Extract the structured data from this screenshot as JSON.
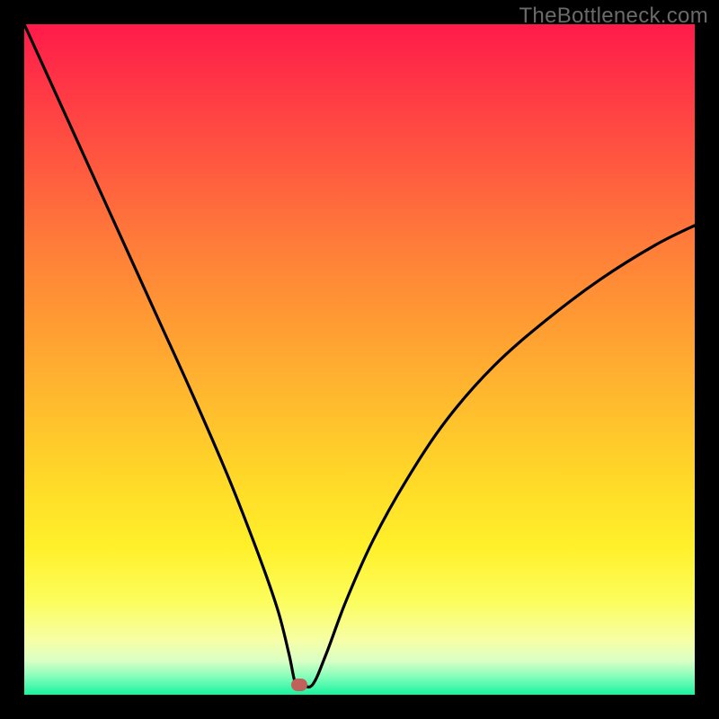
{
  "watermark": "TheBottleneck.com",
  "colors": {
    "frame": "#000000",
    "curve": "#000000",
    "marker": "#c1615b"
  },
  "chart_data": {
    "type": "line",
    "title": "",
    "xlabel": "",
    "ylabel": "",
    "xlim": [
      0,
      100
    ],
    "ylim": [
      0,
      100
    ],
    "series": [
      {
        "name": "bottleneck-curve",
        "x": [
          0,
          5,
          10,
          15,
          20,
          25,
          30,
          33,
          36,
          38,
          39.5,
          40.5,
          41.5,
          43,
          45,
          48,
          52,
          57,
          63,
          70,
          78,
          86,
          94,
          100
        ],
        "y": [
          100,
          89,
          78,
          67,
          56,
          45,
          33.5,
          26,
          18,
          12,
          6,
          1.5,
          1.5,
          1.5,
          6,
          14,
          23,
          32,
          41,
          49,
          56,
          62,
          67,
          70
        ]
      }
    ],
    "marker": {
      "x": 41,
      "y": 1.5
    }
  }
}
